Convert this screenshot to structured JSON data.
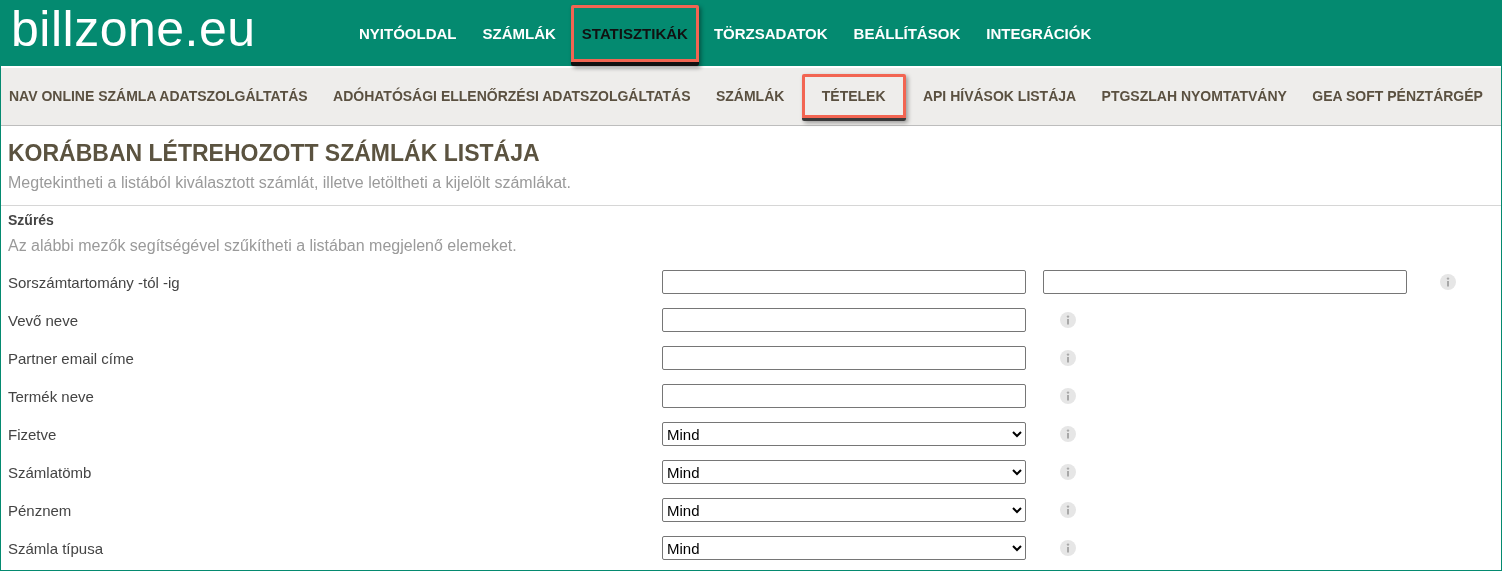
{
  "logo": {
    "text": "billzone.eu"
  },
  "main_nav": [
    {
      "label": "NYITÓOLDAL",
      "selected": false,
      "highlighted": false
    },
    {
      "label": "SZÁMLÁK",
      "selected": false,
      "highlighted": false
    },
    {
      "label": "STATISZTIKÁK",
      "selected": true,
      "highlighted": true
    },
    {
      "label": "TÖRZSADATOK",
      "selected": false,
      "highlighted": false
    },
    {
      "label": "BEÁLLÍTÁSOK",
      "selected": false,
      "highlighted": false
    },
    {
      "label": "INTEGRÁCIÓK",
      "selected": false,
      "highlighted": false
    }
  ],
  "sub_nav": [
    {
      "label": "NAV ONLINE SZÁMLA ADATSZOLGÁLTATÁS",
      "selected": false,
      "highlighted": false
    },
    {
      "label": "ADÓHATÓSÁGI ELLENŐRZÉSI ADATSZOLGÁLTATÁS",
      "selected": false,
      "highlighted": false
    },
    {
      "label": "SZÁMLÁK",
      "selected": false,
      "highlighted": false
    },
    {
      "label": "TÉTELEK",
      "selected": true,
      "highlighted": true
    },
    {
      "label": "API HÍVÁSOK LISTÁJA",
      "selected": false,
      "highlighted": false
    },
    {
      "label": "PTGSZLAH NYOMTATVÁNY",
      "selected": false,
      "highlighted": false
    },
    {
      "label": "GEA SOFT PÉNZTÁRGÉP",
      "selected": false,
      "highlighted": false
    }
  ],
  "page": {
    "title": "KORÁBBAN LÉTREHOZOTT SZÁMLÁK LISTÁJA",
    "subtitle": "Megtekintheti a listából kiválasztott számlát, illetve letöltheti a kijelölt számlákat."
  },
  "filter": {
    "heading": "Szűrés",
    "description": "Az alábbi mezők segítségével szűkítheti a listában megjelenő elemeket.",
    "fields": [
      {
        "kind": "range",
        "label": "Sorszámtartomány -tól -ig"
      },
      {
        "kind": "text",
        "label": "Vevő neve"
      },
      {
        "kind": "text",
        "label": "Partner email címe"
      },
      {
        "kind": "text",
        "label": "Termék neve"
      },
      {
        "kind": "select",
        "label": "Fizetve",
        "value": "Mind"
      },
      {
        "kind": "select",
        "label": "Számlatömb",
        "value": "Mind"
      },
      {
        "kind": "select",
        "label": "Pénznem",
        "value": "Mind"
      },
      {
        "kind": "select",
        "label": "Számla típusa",
        "value": "Mind"
      }
    ]
  }
}
